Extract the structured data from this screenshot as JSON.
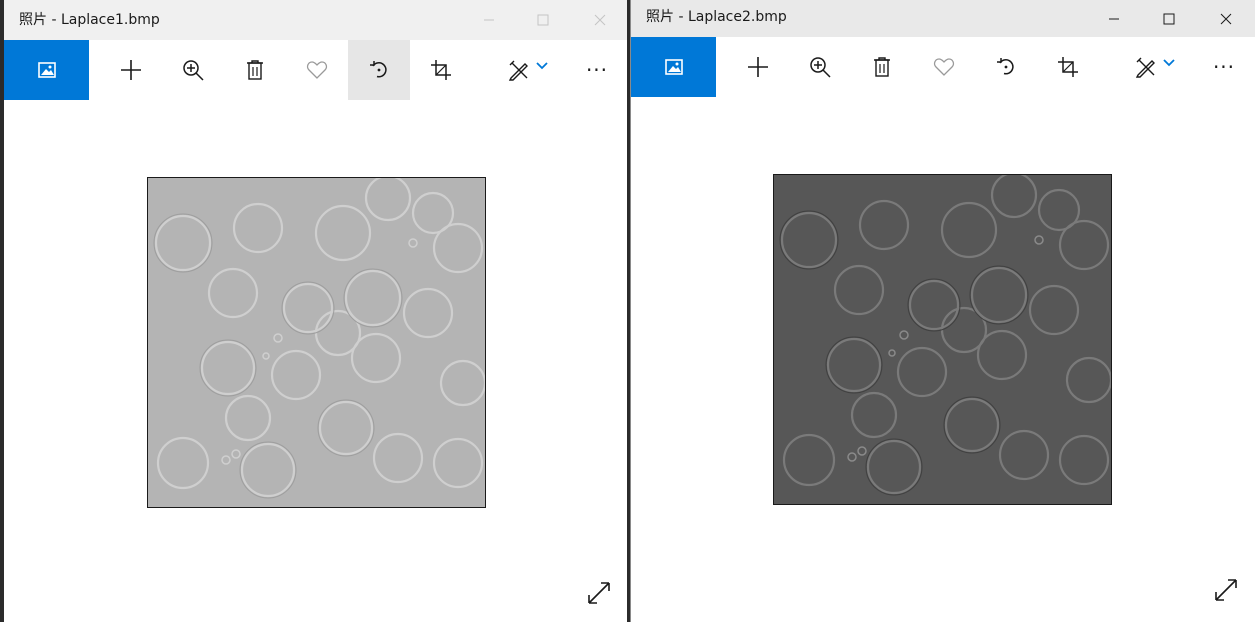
{
  "windows": [
    {
      "title": "照片 - Laplace1.bmp",
      "image_tone": "light gray",
      "controls": [
        "minimize-icon",
        "maximize-icon",
        "close-icon"
      ],
      "toolbar": [
        "photos-home-icon",
        "add-icon",
        "zoom-in-icon",
        "delete-icon",
        "favorite-icon",
        "rotate-icon",
        "crop-icon",
        "edit-create-icon",
        "chevron-down-icon",
        "more-icon"
      ],
      "more_label": "···",
      "hovered_button": "rotate-icon",
      "accent_color": "#0078d7"
    },
    {
      "title": "照片 - Laplace2.bmp",
      "image_tone": "dark gray",
      "controls": [
        "minimize-icon",
        "maximize-icon",
        "close-icon"
      ],
      "toolbar": [
        "photos-home-icon",
        "add-icon",
        "zoom-in-icon",
        "delete-icon",
        "favorite-icon",
        "rotate-icon",
        "crop-icon",
        "edit-create-icon",
        "chevron-down-icon",
        "more-icon"
      ],
      "more_label": "···",
      "accent_color": "#0078d7"
    }
  ]
}
